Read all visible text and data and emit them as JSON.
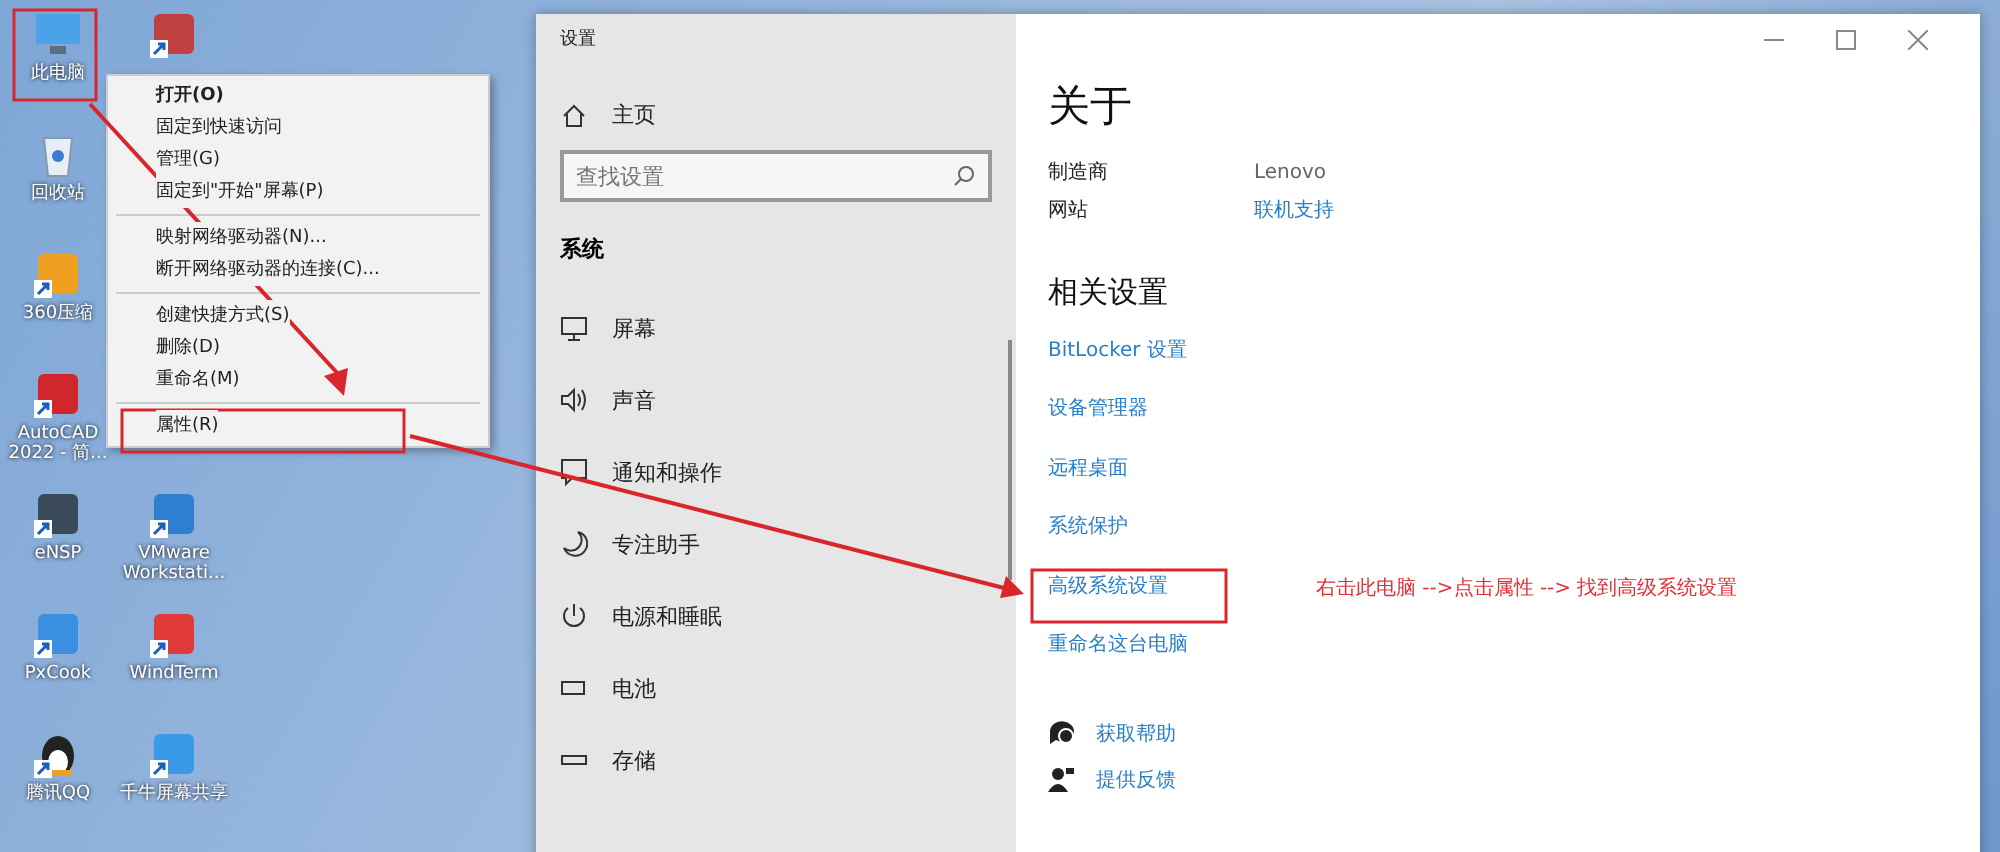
{
  "desktop": {
    "covered_icon": true,
    "column_1": [
      {
        "label": "此电脑"
      },
      {
        "label": "回收站"
      },
      {
        "label": "360压缩"
      },
      {
        "label": "AutoCAD 2022 - 简..."
      },
      {
        "label": "eNSP"
      },
      {
        "label": "PxCook"
      },
      {
        "label": "腾讯QQ"
      }
    ],
    "column_2": [
      {
        "label": "VMware Workstati..."
      },
      {
        "label": "WindTerm"
      },
      {
        "label": "千牛屏幕共享"
      }
    ]
  },
  "context_menu": {
    "groups": [
      [
        {
          "label": "打开(O)",
          "default": true
        },
        {
          "label": "固定到快速访问",
          "default": false
        },
        {
          "label": "管理(G)",
          "default": false
        },
        {
          "label": "固定到\"开始\"屏幕(P)",
          "default": false
        }
      ],
      [
        {
          "label": "映射网络驱动器(N)...",
          "default": false
        },
        {
          "label": "断开网络驱动器的连接(C)...",
          "default": false
        }
      ],
      [
        {
          "label": "创建快捷方式(S)",
          "default": false
        },
        {
          "label": "删除(D)",
          "default": false
        },
        {
          "label": "重命名(M)",
          "default": false
        }
      ],
      [
        {
          "label": "属性(R)",
          "default": false
        }
      ]
    ]
  },
  "settings_window": {
    "title": "设置",
    "sidebar": {
      "home": "主页",
      "search": {
        "placeholder": "查找设置"
      },
      "section": "系统",
      "items": [
        {
          "label": "屏幕"
        },
        {
          "label": "声音"
        },
        {
          "label": "通知和操作"
        },
        {
          "label": "专注助手"
        },
        {
          "label": "电源和睡眠"
        },
        {
          "label": "电池"
        },
        {
          "label": "存储"
        }
      ]
    },
    "content": {
      "title": "关于",
      "specs": [
        {
          "name": "制造商",
          "value": "Lenovo",
          "kind": "text"
        },
        {
          "name": "网站",
          "value": "联机支持",
          "kind": "link"
        }
      ],
      "related_heading": "相关设置",
      "related_links": [
        "BitLocker 设置",
        "设备管理器",
        "远程桌面",
        "系统保护",
        "高级系统设置",
        "重命名这台电脑"
      ],
      "help_links": [
        "获取帮助",
        "提供反馈"
      ]
    }
  },
  "annotation": {
    "text": "右击此电脑 -->点击属性 --> 找到高级系统设置"
  }
}
